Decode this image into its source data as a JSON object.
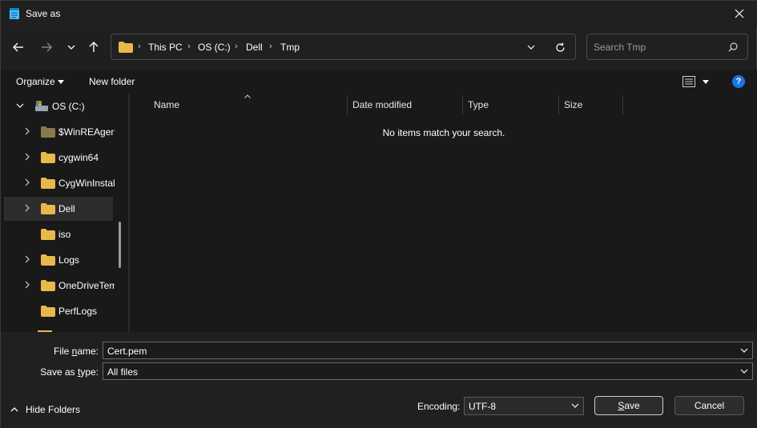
{
  "window": {
    "title": "Save as",
    "close_label": "Close"
  },
  "nav": {
    "back": "Back",
    "forward": "Forward",
    "recent": "Recent locations",
    "up": "Up"
  },
  "address": {
    "crumbs": [
      "This PC",
      "OS (C:)",
      "Dell",
      "Tmp"
    ]
  },
  "search": {
    "placeholder": "Search Tmp"
  },
  "toolbar": {
    "organize_label": "Organize",
    "new_folder_label": "New folder"
  },
  "tree": {
    "root_label": "OS (C:)",
    "items": [
      {
        "label": "$WinREAgent",
        "expandable": true,
        "selected": false,
        "dim": true
      },
      {
        "label": "cygwin64",
        "expandable": true,
        "selected": false,
        "dim": false
      },
      {
        "label": "CygWinInstaller",
        "expandable": true,
        "selected": false,
        "dim": false
      },
      {
        "label": "Dell",
        "expandable": true,
        "selected": true,
        "dim": false
      },
      {
        "label": "iso",
        "expandable": false,
        "selected": false,
        "dim": false
      },
      {
        "label": "Logs",
        "expandable": true,
        "selected": false,
        "dim": false
      },
      {
        "label": "OneDriveTemp",
        "expandable": true,
        "selected": false,
        "dim": false
      },
      {
        "label": "PerfLogs",
        "expandable": false,
        "selected": false,
        "dim": false
      }
    ]
  },
  "columns": {
    "name": "Name",
    "date_modified": "Date modified",
    "type": "Type",
    "size": "Size"
  },
  "file_list": {
    "empty_message": "No items match your search."
  },
  "form": {
    "file_name_label_pre": "File ",
    "file_name_label_u": "n",
    "file_name_label_post": "ame:",
    "file_name_value": "Cert.pem",
    "save_type_label_pre": "Save as ",
    "save_type_label_u": "t",
    "save_type_label_post": "ype:",
    "save_type_value": "All files",
    "encoding_label": "Encoding:",
    "encoding_value": "UTF-8"
  },
  "buttons": {
    "hide_folders": "Hide Folders",
    "save_u": "S",
    "save_rest": "ave",
    "cancel": "Cancel"
  },
  "colors": {
    "folder": "#e8b84a",
    "help": "#1a73e8",
    "selected_bg": "#2d2d2d"
  }
}
